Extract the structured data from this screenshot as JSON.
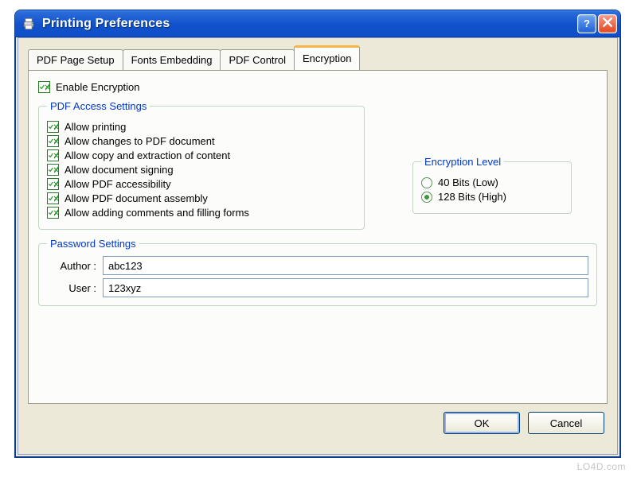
{
  "window": {
    "title": "Printing Preferences"
  },
  "tabs": {
    "page_setup": "PDF Page Setup",
    "fonts": "Fonts Embedding",
    "control": "PDF Control",
    "encryption": "Encryption"
  },
  "encryption": {
    "enable_label": "Enable Encryption",
    "access_group": "PDF Access Settings",
    "access": {
      "printing": "Allow printing",
      "changes": "Allow changes to PDF document",
      "copy": "Allow copy and extraction of content",
      "signing": "Allow document signing",
      "accessibility": "Allow PDF accessibility",
      "assembly": "Allow PDF document assembly",
      "comments": "Allow adding comments and filling forms"
    },
    "level_group": "Encryption Level",
    "level": {
      "bits40": "40 Bits (Low)",
      "bits128": "128 Bits (High)"
    },
    "password_group": "Password Settings",
    "password": {
      "author_label": "Author :",
      "author_value": "abc123",
      "user_label": "User :",
      "user_value": "123xyz"
    }
  },
  "buttons": {
    "ok": "OK",
    "cancel": "Cancel"
  },
  "watermark": "LO4D.com"
}
